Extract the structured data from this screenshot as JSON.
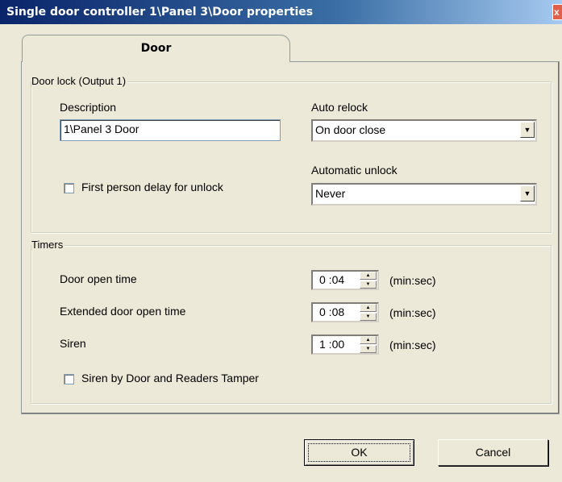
{
  "window": {
    "title": "Single door controller 1\\Panel 3\\Door properties",
    "close_glyph": "x"
  },
  "tabs": [
    {
      "label": "Door",
      "selected": true
    }
  ],
  "door_lock": {
    "legend": "Door lock (Output 1)",
    "description_label": "Description",
    "description_value": "1\\Panel 3  Door",
    "auto_relock_label": "Auto relock",
    "auto_relock_value": "On door close",
    "first_person_delay_label": "First person delay for unlock",
    "first_person_delay_checked": false,
    "automatic_unlock_label": "Automatic unlock",
    "automatic_unlock_value": "Never"
  },
  "timers": {
    "legend": "Timers",
    "unit": "(min:sec)",
    "door_open_time_label": "Door open time",
    "door_open_time_value": "0 :04",
    "extended_door_open_time_label": "Extended  door open time",
    "extended_door_open_time_value": "0 :08",
    "siren_label": "Siren",
    "siren_value": "1 :00",
    "siren_tamper_label": "Siren by Door and Readers Tamper",
    "siren_tamper_checked": false
  },
  "buttons": {
    "ok": "OK",
    "cancel": "Cancel"
  },
  "icons": {
    "dropdown": "▼",
    "spin_up": "▲",
    "spin_down": "▼"
  }
}
